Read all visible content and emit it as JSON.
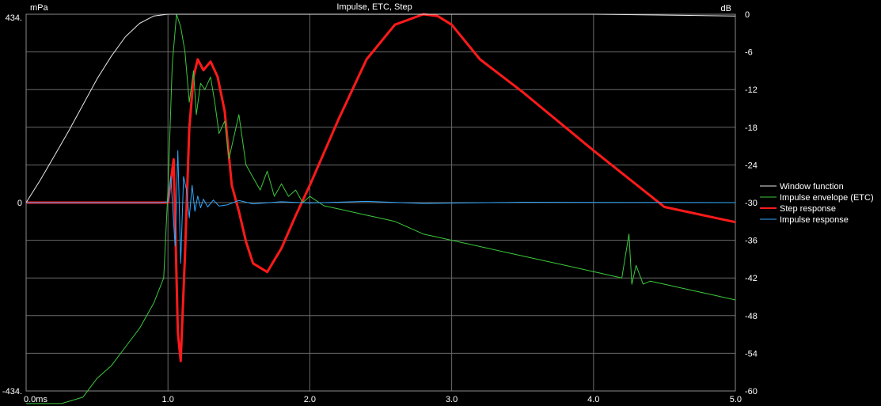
{
  "chart_data": {
    "type": "line",
    "title": "Impulse, ETC, Step",
    "left_axis": {
      "unit": "mPa",
      "ticks": [
        434,
        0,
        -434
      ],
      "tick_labels": [
        "434.",
        "0",
        "-434."
      ],
      "range": [
        -434,
        434
      ]
    },
    "right_axis": {
      "unit": "dB",
      "ticks": [
        0,
        -6,
        -12,
        -18,
        -24,
        -30,
        -36,
        -42,
        -48,
        -54,
        -60
      ],
      "range": [
        -60,
        0
      ]
    },
    "x_axis": {
      "ticks": [
        0,
        1,
        2,
        3,
        4,
        5
      ],
      "tick_labels": [
        "0.0ms",
        "1.0",
        "2.0",
        "3.0",
        "4.0",
        "5.0"
      ],
      "range": [
        0,
        5
      ]
    },
    "grid": true,
    "legend_position": "center-right",
    "series": [
      {
        "name": "Window function",
        "axis": "left",
        "color": "#e8e8e8",
        "width": 1,
        "x": [
          0,
          0.1,
          0.2,
          0.3,
          0.4,
          0.5,
          0.6,
          0.7,
          0.8,
          0.9,
          1.0,
          1.5,
          2.0,
          3.0,
          4.0,
          5.0
        ],
        "values": [
          0,
          52,
          108,
          165,
          225,
          285,
          337,
          382,
          413,
          430,
          434,
          434,
          434,
          434,
          434,
          430
        ]
      },
      {
        "name": "Impulse envelope (ETC)",
        "axis": "right",
        "color": "#3cc83c",
        "width": 1,
        "x": [
          0,
          0.25,
          0.4,
          0.5,
          0.6,
          0.7,
          0.8,
          0.9,
          0.97,
          1.0,
          1.03,
          1.06,
          1.09,
          1.12,
          1.15,
          1.18,
          1.2,
          1.23,
          1.26,
          1.3,
          1.33,
          1.36,
          1.4,
          1.43,
          1.46,
          1.5,
          1.55,
          1.6,
          1.65,
          1.7,
          1.75,
          1.8,
          1.85,
          1.9,
          1.95,
          2.0,
          2.1,
          2.2,
          2.3,
          2.4,
          2.5,
          2.6,
          2.7,
          2.8,
          2.9,
          3.0,
          3.2,
          3.4,
          3.6,
          3.8,
          4.0,
          4.1,
          4.2,
          4.25,
          4.27,
          4.3,
          4.35,
          4.4,
          4.5,
          4.6,
          4.7,
          4.8,
          4.9,
          5.0
        ],
        "values": [
          -62,
          -62,
          -61,
          -58,
          -56,
          -53,
          -50,
          -46,
          -42,
          -28,
          -8,
          0,
          -2,
          -6,
          -14,
          -9,
          -16,
          -11,
          -12,
          -10,
          -14,
          -19,
          -17,
          -23,
          -20,
          -16,
          -24,
          -26,
          -28,
          -25,
          -29,
          -27,
          -29,
          -28,
          -30,
          -29,
          -30.5,
          -31,
          -31.5,
          -32,
          -32.5,
          -33,
          -34,
          -35,
          -35.5,
          -36,
          -37,
          -38,
          -39,
          -40,
          -41,
          -41.5,
          -42,
          -35,
          -43,
          -40,
          -43,
          -42.5,
          -43,
          -43.5,
          -44,
          -44.5,
          -45,
          -45.5
        ]
      },
      {
        "name": "Step response",
        "axis": "left",
        "color": "#ff1a1a",
        "width": 3,
        "x": [
          0,
          0.9,
          1.0,
          1.04,
          1.07,
          1.09,
          1.12,
          1.15,
          1.18,
          1.21,
          1.25,
          1.3,
          1.35,
          1.4,
          1.45,
          1.5,
          1.55,
          1.6,
          1.7,
          1.8,
          1.9,
          2.0,
          2.2,
          2.4,
          2.6,
          2.8,
          2.9,
          3.0,
          3.2,
          3.5,
          4.0,
          4.5,
          5.0
        ],
        "values": [
          0,
          0,
          0,
          100,
          -300,
          -365,
          -120,
          170,
          290,
          330,
          305,
          325,
          290,
          210,
          40,
          -20,
          -90,
          -140,
          -160,
          -105,
          -30,
          40,
          190,
          330,
          410,
          434,
          430,
          410,
          330,
          255,
          120,
          -10,
          -45
        ]
      },
      {
        "name": "Impulse response",
        "axis": "left",
        "color": "#2ea8ff",
        "width": 1,
        "x": [
          0,
          0.95,
          1.0,
          1.02,
          1.05,
          1.07,
          1.09,
          1.11,
          1.13,
          1.15,
          1.17,
          1.19,
          1.21,
          1.23,
          1.25,
          1.28,
          1.32,
          1.36,
          1.42,
          1.5,
          1.6,
          1.8,
          2.0,
          2.4,
          2.8,
          3.5,
          5.0
        ],
        "values": [
          0,
          0,
          2,
          60,
          -100,
          120,
          -140,
          60,
          30,
          -35,
          40,
          -20,
          15,
          -12,
          8,
          -10,
          6,
          -8,
          -5,
          5,
          -3,
          2,
          -1,
          3,
          -2,
          1,
          0
        ]
      }
    ]
  }
}
